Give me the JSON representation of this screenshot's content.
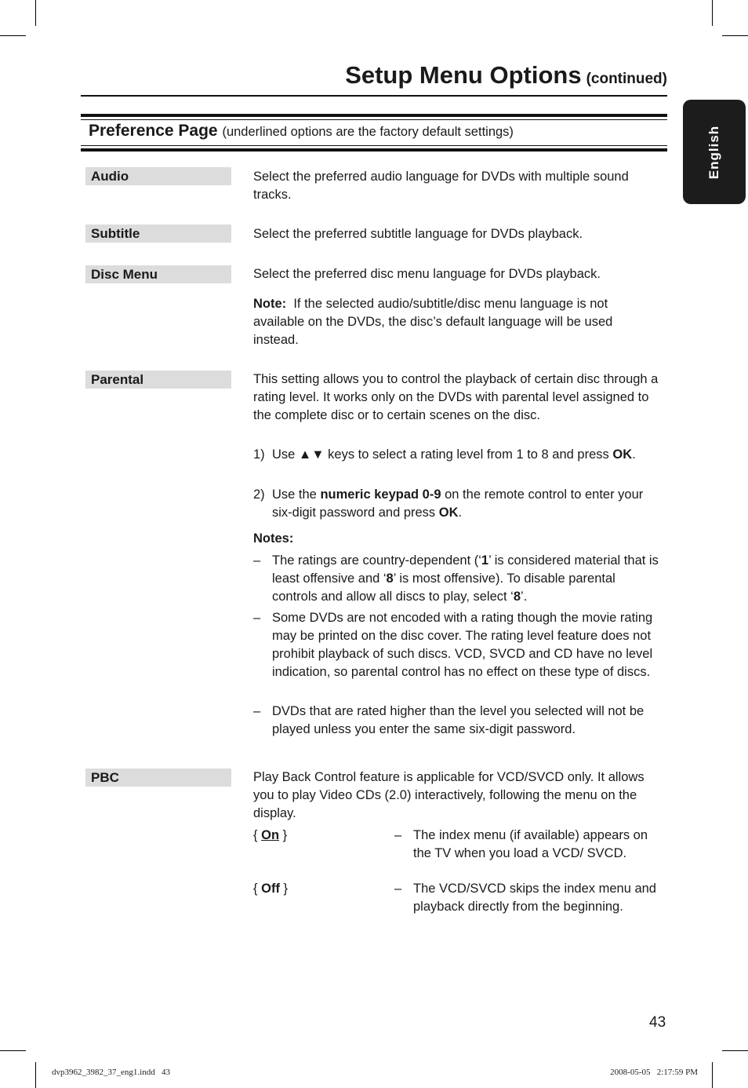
{
  "header": {
    "title": "Setup Menu Options",
    "title_suffix": "(continued)",
    "language_tab": "English"
  },
  "section": {
    "title": "Preference Page",
    "subtitle": "(underlined options are the factory default settings)"
  },
  "items": {
    "audio": {
      "label": "Audio",
      "text": "Select the preferred audio language for DVDs with multiple sound tracks."
    },
    "subtitle": {
      "label": "Subtitle",
      "text": "Select the preferred subtitle language for DVDs playback."
    },
    "disc_menu": {
      "label": "Disc Menu",
      "text": "Select the preferred disc menu language for DVDs playback.",
      "note_label": "Note:",
      "note_text": "If the selected audio/subtitle/disc menu language is not available on the DVDs, the disc’s default language will be used instead."
    },
    "parental": {
      "label": "Parental",
      "text": "This setting allows you to control the playback of certain disc through a rating level. It works only on the DVDs with parental level assigned to the complete disc or to certain scenes on the disc.",
      "steps": [
        {
          "num": "1)",
          "pre": "Use ▲▼ keys to select a rating level from 1 to 8 and press ",
          "bold": "OK",
          "post": "."
        },
        {
          "num": "2)",
          "pre": "Use the ",
          "bold": "numeric keypad 0-9",
          "mid": " on the remote control to enter your six-digit password and press ",
          "bold2": "OK",
          "post": "."
        }
      ],
      "notes_label": "Notes:",
      "notes": [
        {
          "a": "The ratings are country-dependent (‘",
          "b1": "1",
          "c": "’ is considered material that is least offensive and ‘",
          "b2": "8",
          "d": "’ is most offensive). To disable parental controls and allow all discs to play, select ‘",
          "b3": "8",
          "e": "’."
        },
        {
          "a": "Some DVDs are not encoded with a rating though the movie rating may be printed on the disc cover. The rating level feature does not prohibit playback of such discs. VCD, SVCD and CD have no level indication, so parental control has no effect on these type of discs."
        },
        {
          "a": "DVDs that are rated higher than the level you selected will not be played unless you enter the same six-digit password."
        }
      ]
    },
    "pbc": {
      "label": "PBC",
      "text": "Play Back Control feature is applicable for VCD/SVCD only. It allows you to play Video CDs (2.0) interactively, following the menu on the display.",
      "options": [
        {
          "name": "On",
          "default": true,
          "desc": "The index menu (if available) appears on the TV when you load a VCD/ SVCD."
        },
        {
          "name": "Off",
          "default": false,
          "desc": "The VCD/SVCD skips the index menu and playback directly from the beginning."
        }
      ]
    }
  },
  "page_number": "43",
  "footer": {
    "file": "dvp3962_3982_37_eng1.indd   43",
    "timestamp": "2008-05-05   2:17:59 PM"
  }
}
